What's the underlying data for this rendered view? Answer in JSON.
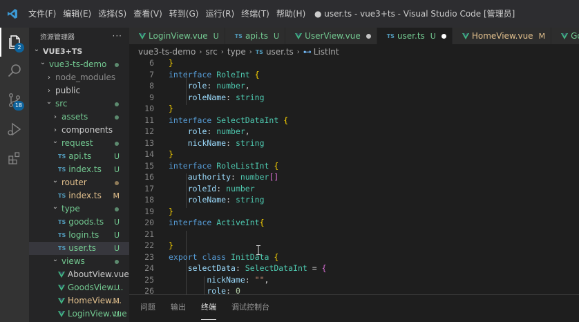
{
  "menu": [
    "文件(F)",
    "编辑(E)",
    "选择(S)",
    "查看(V)",
    "转到(G)",
    "运行(R)",
    "终端(T)",
    "帮助(H)"
  ],
  "window_title": "● user.ts - vue3+ts - Visual Studio Code [管理员]",
  "activity": {
    "explorer_badge": "2",
    "scm_badge": "18"
  },
  "sidebar": {
    "title": "资源管理器",
    "more": "···"
  },
  "tree": [
    {
      "label": "VUE3+TS",
      "indent": 0,
      "kind": "folder-open",
      "status": "",
      "bold": true
    },
    {
      "label": "vue3-ts-demo",
      "indent": 1,
      "kind": "folder-open",
      "status": "dot"
    },
    {
      "label": "node_modules",
      "indent": 2,
      "kind": "folder",
      "status": "",
      "dim": true
    },
    {
      "label": "public",
      "indent": 2,
      "kind": "folder",
      "status": ""
    },
    {
      "label": "src",
      "indent": 2,
      "kind": "folder-open",
      "status": "dot"
    },
    {
      "label": "assets",
      "indent": 3,
      "kind": "folder",
      "status": "dot"
    },
    {
      "label": "components",
      "indent": 3,
      "kind": "folder",
      "status": ""
    },
    {
      "label": "request",
      "indent": 3,
      "kind": "folder-open",
      "status": "dot"
    },
    {
      "label": "api.ts",
      "indent": 4,
      "kind": "ts",
      "status": "U"
    },
    {
      "label": "index.ts",
      "indent": 4,
      "kind": "ts",
      "status": "U"
    },
    {
      "label": "router",
      "indent": 3,
      "kind": "folder-open",
      "status": "dot-m"
    },
    {
      "label": "index.ts",
      "indent": 4,
      "kind": "ts",
      "status": "M"
    },
    {
      "label": "type",
      "indent": 3,
      "kind": "folder-open",
      "status": "dot"
    },
    {
      "label": "goods.ts",
      "indent": 4,
      "kind": "ts",
      "status": "U"
    },
    {
      "label": "login.ts",
      "indent": 4,
      "kind": "ts",
      "status": "U"
    },
    {
      "label": "user.ts",
      "indent": 4,
      "kind": "ts",
      "status": "U",
      "selected": true
    },
    {
      "label": "views",
      "indent": 3,
      "kind": "folder-open",
      "status": "dot"
    },
    {
      "label": "AboutView.vue",
      "indent": 4,
      "kind": "vue",
      "status": ""
    },
    {
      "label": "GoodsView....",
      "indent": 4,
      "kind": "vue",
      "status": "U"
    },
    {
      "label": "HomeView....",
      "indent": 4,
      "kind": "vue",
      "status": "M"
    },
    {
      "label": "LoginView.vue",
      "indent": 4,
      "kind": "vue",
      "status": "U"
    }
  ],
  "tabs": [
    {
      "label": "LoginView.vue",
      "kind": "vue",
      "status": "U",
      "color": "#73c991"
    },
    {
      "label": "api.ts",
      "kind": "ts",
      "status": "U",
      "color": "#73c991"
    },
    {
      "label": "UserView.vue",
      "kind": "vue",
      "status": "dot",
      "color": "#73c991"
    },
    {
      "label": "user.ts",
      "kind": "ts",
      "status": "U-dot",
      "color": "#73c991",
      "active": true
    },
    {
      "label": "HomeView.vue",
      "kind": "vue",
      "status": "M",
      "color": "#e2c08d"
    },
    {
      "label": "Good",
      "kind": "vue",
      "status": "",
      "color": "#73c991"
    }
  ],
  "tab_status": {
    "U": "U",
    "M": "M"
  },
  "breadcrumb": [
    "vue3-ts-demo",
    "src",
    "type",
    "user.ts",
    "ListInt"
  ],
  "breadcrumb_icons": {
    "ts": "TS",
    "symbol": "⊷"
  },
  "code": [
    {
      "n": "6",
      "t": [
        [
          "}",
          "br"
        ]
      ]
    },
    {
      "n": "7",
      "t": [
        [
          "interface ",
          "kw"
        ],
        [
          "RoleInt",
          "ty"
        ],
        [
          " ",
          "pu"
        ],
        [
          "{",
          "br"
        ]
      ]
    },
    {
      "n": "8",
      "t": [
        [
          "    role",
          "pr"
        ],
        [
          ": ",
          "pu"
        ],
        [
          "number",
          "ty"
        ],
        [
          ",",
          "pu"
        ]
      ]
    },
    {
      "n": "9",
      "t": [
        [
          "    roleName",
          "pr"
        ],
        [
          ": ",
          "pu"
        ],
        [
          "string",
          "ty"
        ]
      ]
    },
    {
      "n": "10",
      "t": [
        [
          "}",
          "br"
        ]
      ]
    },
    {
      "n": "11",
      "t": [
        [
          "interface ",
          "kw"
        ],
        [
          "SelectDataInt",
          "ty"
        ],
        [
          " ",
          "pu"
        ],
        [
          "{",
          "br"
        ]
      ]
    },
    {
      "n": "12",
      "t": [
        [
          "    role",
          "pr"
        ],
        [
          ": ",
          "pu"
        ],
        [
          "number",
          "ty"
        ],
        [
          ",",
          "pu"
        ]
      ]
    },
    {
      "n": "13",
      "t": [
        [
          "    nickName",
          "pr"
        ],
        [
          ": ",
          "pu"
        ],
        [
          "string",
          "ty"
        ]
      ]
    },
    {
      "n": "14",
      "t": [
        [
          "}",
          "br"
        ]
      ]
    },
    {
      "n": "15",
      "t": [
        [
          "interface ",
          "kw"
        ],
        [
          "RoleListInt",
          "ty"
        ],
        [
          " ",
          "pu"
        ],
        [
          "{",
          "br"
        ]
      ]
    },
    {
      "n": "16",
      "t": [
        [
          "    authority",
          "pr"
        ],
        [
          ": ",
          "pu"
        ],
        [
          "number",
          "ty"
        ],
        [
          "[]",
          "br2"
        ]
      ]
    },
    {
      "n": "17",
      "t": [
        [
          "    roleId",
          "pr"
        ],
        [
          ": ",
          "pu"
        ],
        [
          "number",
          "ty"
        ]
      ]
    },
    {
      "n": "18",
      "t": [
        [
          "    roleName",
          "pr"
        ],
        [
          ": ",
          "pu"
        ],
        [
          "string",
          "ty"
        ]
      ]
    },
    {
      "n": "19",
      "t": [
        [
          "}",
          "br"
        ]
      ]
    },
    {
      "n": "20",
      "t": [
        [
          "interface ",
          "kw"
        ],
        [
          "ActiveInt",
          "ty"
        ],
        [
          "{",
          "br"
        ]
      ]
    },
    {
      "n": "21",
      "t": []
    },
    {
      "n": "22",
      "t": [
        [
          "}",
          "br"
        ]
      ]
    },
    {
      "n": "23",
      "t": [
        [
          "export ",
          "kw"
        ],
        [
          "class ",
          "kw"
        ],
        [
          "InitData",
          "ty"
        ],
        [
          " ",
          "pu"
        ],
        [
          "{",
          "br"
        ]
      ]
    },
    {
      "n": "24",
      "t": [
        [
          "    selectData",
          "pr"
        ],
        [
          ": ",
          "pu"
        ],
        [
          "SelectDataInt",
          "ty"
        ],
        [
          " = ",
          "pu"
        ],
        [
          "{",
          "br2"
        ]
      ]
    },
    {
      "n": "25",
      "t": [
        [
          "        nickName",
          "pr"
        ],
        [
          ": ",
          "pu"
        ],
        [
          "\"\"",
          "st"
        ],
        [
          ",",
          "pu"
        ]
      ]
    },
    {
      "n": "26",
      "t": [
        [
          "        role",
          "pr"
        ],
        [
          ": ",
          "pu"
        ],
        [
          "0",
          "nu"
        ]
      ]
    }
  ],
  "panel_tabs": [
    {
      "label": "问题",
      "active": false
    },
    {
      "label": "输出",
      "active": false
    },
    {
      "label": "终端",
      "active": true
    },
    {
      "label": "调试控制台",
      "active": false
    }
  ],
  "colors": {
    "untracked": "#73c991",
    "modified": "#e2c08d",
    "accent": "#0e639c",
    "vue": "#41b883",
    "ts": "#519aba"
  }
}
